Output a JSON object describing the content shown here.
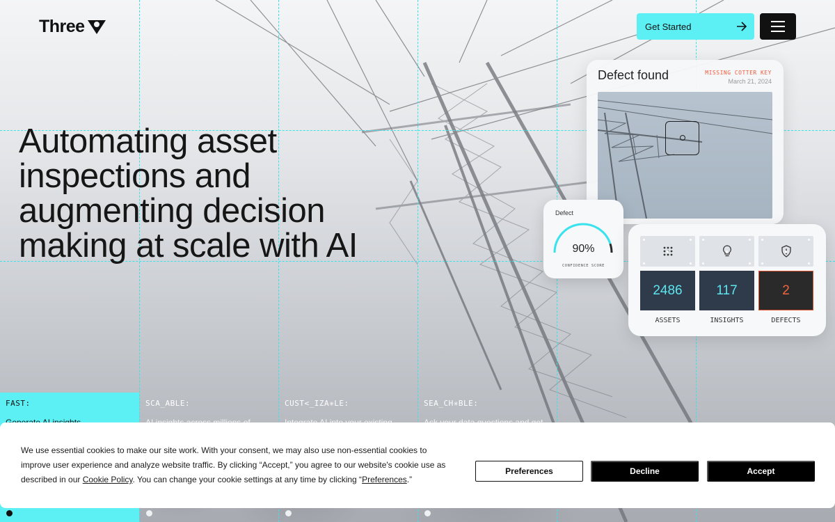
{
  "brand": {
    "name": "Three",
    "logo_icon": "v-pin-logo-icon"
  },
  "header": {
    "cta_label": "Get Started",
    "cta_icon": "arrow-right-icon",
    "menu_icon": "hamburger-menu-icon"
  },
  "hero": {
    "headline": "Automating asset inspections and augmenting decision making at scale with AI"
  },
  "defect_card": {
    "title": "Defect found",
    "tag": "MISSING COTTER KEY",
    "date": "March 21, 2024"
  },
  "confidence": {
    "label": "Defect",
    "value": "90%",
    "level": 0.9,
    "caption": "CONFIDENCE SCORE"
  },
  "stats": {
    "items": [
      {
        "icon": "grid-dots-icon",
        "value": "2486",
        "label": "ASSETS"
      },
      {
        "icon": "lightbulb-icon",
        "value": "117",
        "label": "INSIGHTS"
      },
      {
        "icon": "shield-alert-icon",
        "value": "2",
        "label": "DEFECTS"
      }
    ]
  },
  "features": [
    {
      "title": "FAST:",
      "desc": "Generate AI insights"
    },
    {
      "title": "SCA_ABLE:",
      "desc": "AI insights across millions of"
    },
    {
      "title": "CUST<_IZA✳LE:",
      "desc": "Integrate AI into your existing"
    },
    {
      "title": "SEA_CH✳BLE:",
      "desc": "Ask your data questions and get"
    }
  ],
  "cookie": {
    "text_1": "We use essential cookies to make our site work. With your consent, we may also use non-essential cookies to improve user experience and analyze website traffic. By clicking “Accept,” you agree to our website's cookie use as described in our ",
    "policy_link": "Cookie Policy",
    "text_2": ". You can change your cookie settings at any time by clicking “",
    "prefs_link": "Preferences",
    "text_3": ".”",
    "buttons": {
      "preferences": "Preferences",
      "decline": "Decline",
      "accept": "Accept"
    }
  },
  "colors": {
    "accent_cyan": "#5cf0f4",
    "alert_orange": "#ee5a3c",
    "stat_navy": "#2f3b4b"
  }
}
